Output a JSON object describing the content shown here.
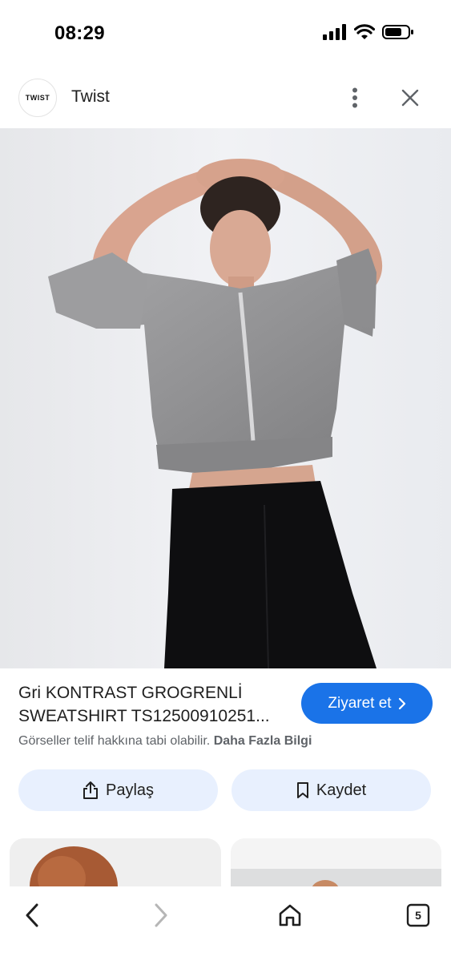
{
  "status_bar": {
    "time": "08:29",
    "icons": [
      "signal-icon",
      "wifi-icon",
      "battery-icon"
    ]
  },
  "source": {
    "logo_text": "TWIST",
    "name": "Twist"
  },
  "product": {
    "title_line1": "Gri KONTRAST GROGRENLİ",
    "title_line2": "SWEATSHIRT TS12500910251..."
  },
  "visit_button": {
    "label": "Ziyaret et"
  },
  "copyright": {
    "text": "Görseller telif hakkına tabi olabilir.",
    "link": "Daha Fazla Bilgi"
  },
  "actions": {
    "share_label": "Paylaş",
    "save_label": "Kaydet"
  },
  "bottom_nav": {
    "tab_count": "5"
  },
  "colors": {
    "accent": "#1a73e8",
    "pill_bg": "#e8f0fe",
    "secondary_text": "#5f6368"
  }
}
